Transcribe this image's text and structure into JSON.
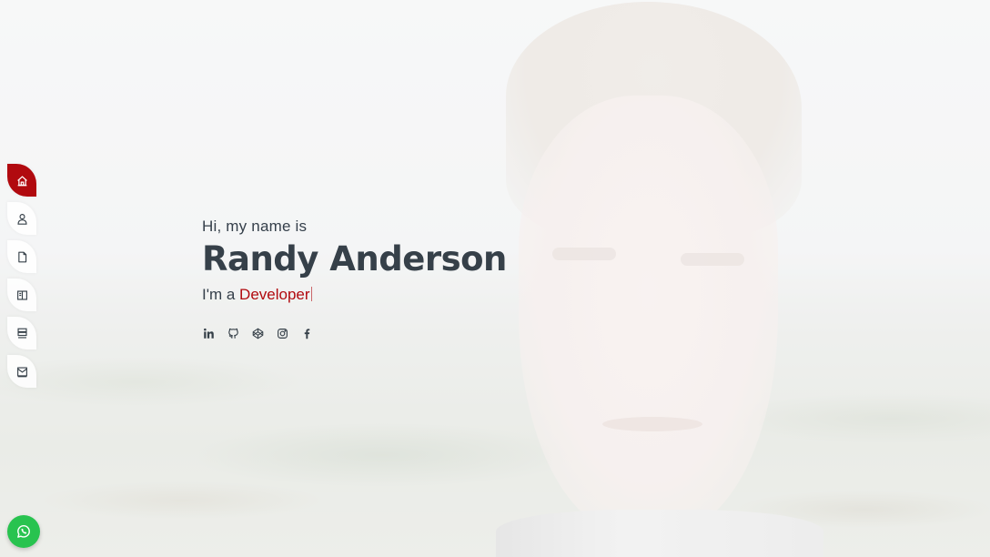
{
  "hero": {
    "greeting": "Hi, my name is",
    "name": "Randy Anderson",
    "role_prefix": "I'm a",
    "role_typed": "Developer"
  },
  "side_nav": {
    "items": [
      {
        "icon": "home-icon",
        "active": true
      },
      {
        "icon": "user-icon",
        "active": false
      },
      {
        "icon": "file-icon",
        "active": false
      },
      {
        "icon": "book-icon",
        "active": false
      },
      {
        "icon": "server-icon",
        "active": false
      },
      {
        "icon": "mail-icon",
        "active": false
      }
    ]
  },
  "social_links": [
    {
      "icon": "linkedin-icon"
    },
    {
      "icon": "github-icon"
    },
    {
      "icon": "codepen-icon"
    },
    {
      "icon": "instagram-icon"
    },
    {
      "icon": "facebook-icon"
    }
  ],
  "floating": {
    "whatsapp_icon": "whatsapp-icon"
  },
  "colors": {
    "accent": "#b10a0f",
    "text": "#364049",
    "whatsapp": "#28c34f"
  }
}
